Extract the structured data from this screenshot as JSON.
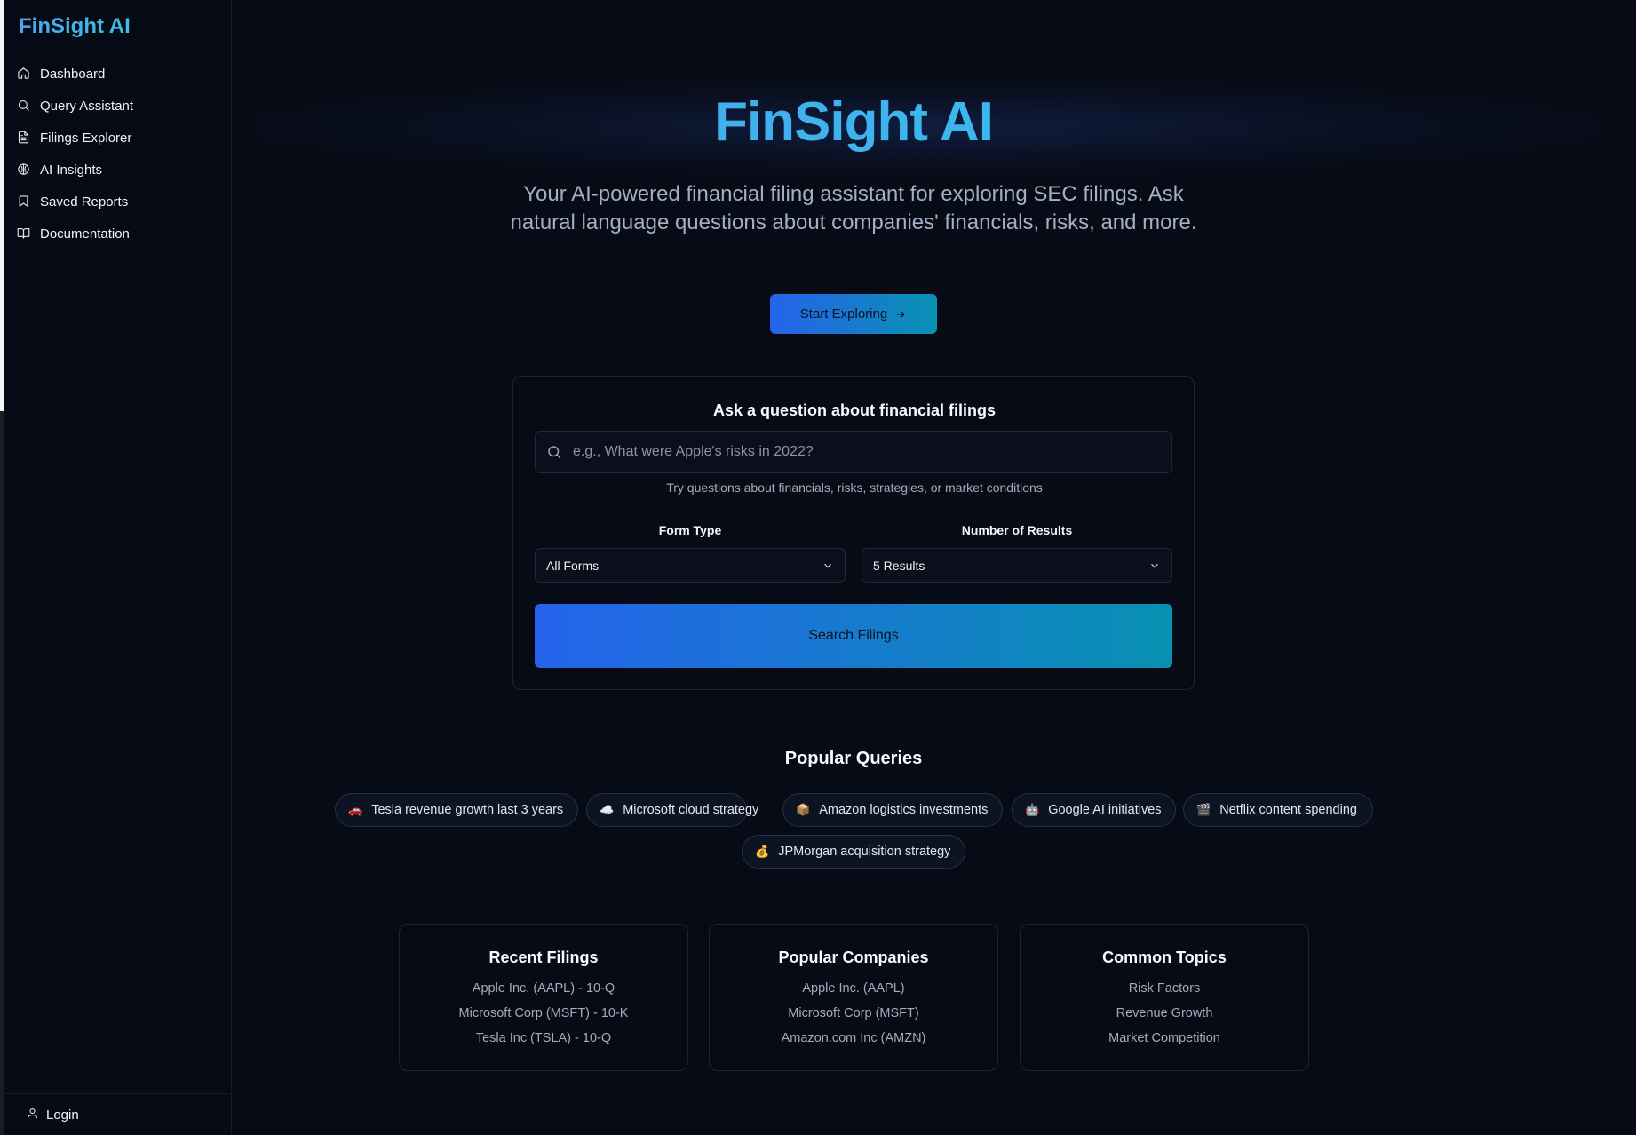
{
  "sidebar": {
    "brand": "FinSight AI",
    "items": [
      {
        "label": "Dashboard",
        "icon": "home-icon"
      },
      {
        "label": "Query Assistant",
        "icon": "search-icon"
      },
      {
        "label": "Filings Explorer",
        "icon": "file-text-icon"
      },
      {
        "label": "AI Insights",
        "icon": "brain-icon"
      },
      {
        "label": "Saved Reports",
        "icon": "bookmark-icon"
      },
      {
        "label": "Documentation",
        "icon": "book-open-icon"
      }
    ],
    "login_label": "Login"
  },
  "hero": {
    "title": "FinSight AI",
    "subtitle": "Your AI-powered financial filing assistant for exploring SEC filings. Ask natural language questions about companies' financials, risks, and more.",
    "cta_label": "Start Exploring"
  },
  "query_card": {
    "title": "Ask a question about financial filings",
    "search_placeholder": "e.g., What were Apple's risks in 2022?",
    "hint": "Try questions about financials, risks, strategies, or market conditions",
    "form_type_label": "Form Type",
    "form_type_value": "All Forms",
    "results_label": "Number of Results",
    "results_value": "5 Results",
    "submit_label": "Search Filings"
  },
  "popular_queries": {
    "title": "Popular Queries",
    "items": [
      {
        "emoji": "🚗",
        "label": "Tesla revenue growth last 3 years"
      },
      {
        "emoji": "☁️",
        "label": "Microsoft cloud strategy"
      },
      {
        "emoji": "📦",
        "label": "Amazon logistics investments"
      },
      {
        "emoji": "🤖",
        "label": "Google AI initiatives"
      },
      {
        "emoji": "🎬",
        "label": "Netflix content spending"
      },
      {
        "emoji": "💰",
        "label": "JPMorgan acquisition strategy"
      }
    ]
  },
  "info_cards": [
    {
      "title": "Recent Filings",
      "items": [
        "Apple Inc. (AAPL) - 10-Q",
        "Microsoft Corp (MSFT) - 10-K",
        "Tesla Inc (TSLA) - 10-Q"
      ]
    },
    {
      "title": "Popular Companies",
      "items": [
        "Apple Inc. (AAPL)",
        "Microsoft Corp (MSFT)",
        "Amazon.com Inc (AMZN)"
      ]
    },
    {
      "title": "Common Topics",
      "items": [
        "Risk Factors",
        "Revenue Growth",
        "Market Competition"
      ]
    }
  ],
  "colors": {
    "background": "#070b16",
    "accent_start": "#2563eb",
    "accent_end": "#0891b2",
    "brand_gradient_start": "#4ea0f1",
    "brand_gradient_end": "#2fc6ea"
  }
}
